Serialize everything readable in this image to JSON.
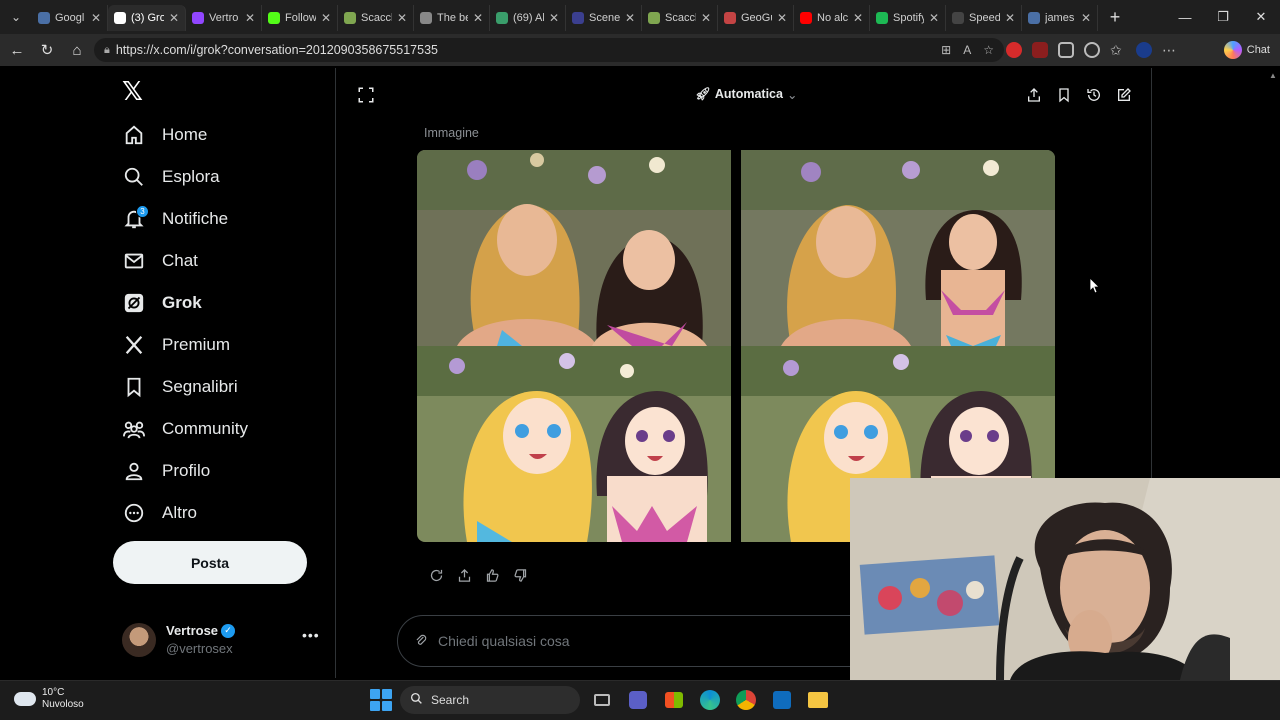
{
  "browser": {
    "tabs": [
      {
        "label": "Googl",
        "color": "#4a6fa5"
      },
      {
        "label": "(3) Gro",
        "color": "#ffffff",
        "active": true
      },
      {
        "label": "Vertro",
        "color": "#9146ff"
      },
      {
        "label": "Follow",
        "color": "#53fc18"
      },
      {
        "label": "Scacch",
        "color": "#7fa650"
      },
      {
        "label": "The be",
        "color": "#888888"
      },
      {
        "label": "(69) Al",
        "color": "#3a9e6b"
      },
      {
        "label": "Scene",
        "color": "#3b3f8f"
      },
      {
        "label": "Scacch",
        "color": "#7fa650"
      },
      {
        "label": "GeoGu",
        "color": "#c44444"
      },
      {
        "label": "No alc",
        "color": "#ff0000"
      },
      {
        "label": "Spotify",
        "color": "#1db954"
      },
      {
        "label": "Speed",
        "color": "#444444"
      },
      {
        "label": "james",
        "color": "#4a6fa5"
      }
    ],
    "url": "https://x.com/i/grok?conversation=2012090358675517535",
    "copilot_label": "Chat"
  },
  "sidebar": {
    "items": [
      {
        "label": "Home"
      },
      {
        "label": "Esplora"
      },
      {
        "label": "Notifiche",
        "badge": "3"
      },
      {
        "label": "Chat"
      },
      {
        "label": "Grok"
      },
      {
        "label": "Premium"
      },
      {
        "label": "Segnalibri"
      },
      {
        "label": "Community"
      },
      {
        "label": "Profilo"
      },
      {
        "label": "Altro"
      }
    ],
    "post_button": "Posta",
    "profile": {
      "name": "Vertrose",
      "handle": "@vertrosex"
    }
  },
  "main": {
    "mode_label": "Automatica",
    "image_section_label": "Immagine",
    "ask_placeholder": "Chiedi qualsiasi cosa"
  },
  "taskbar": {
    "temperature": "10°C",
    "weather": "Nuvoloso",
    "search_label": "Search"
  },
  "colors": {
    "background": "#000000",
    "accent": "#1d9bf0",
    "text": "#e7e9ea",
    "muted": "#71767b"
  }
}
